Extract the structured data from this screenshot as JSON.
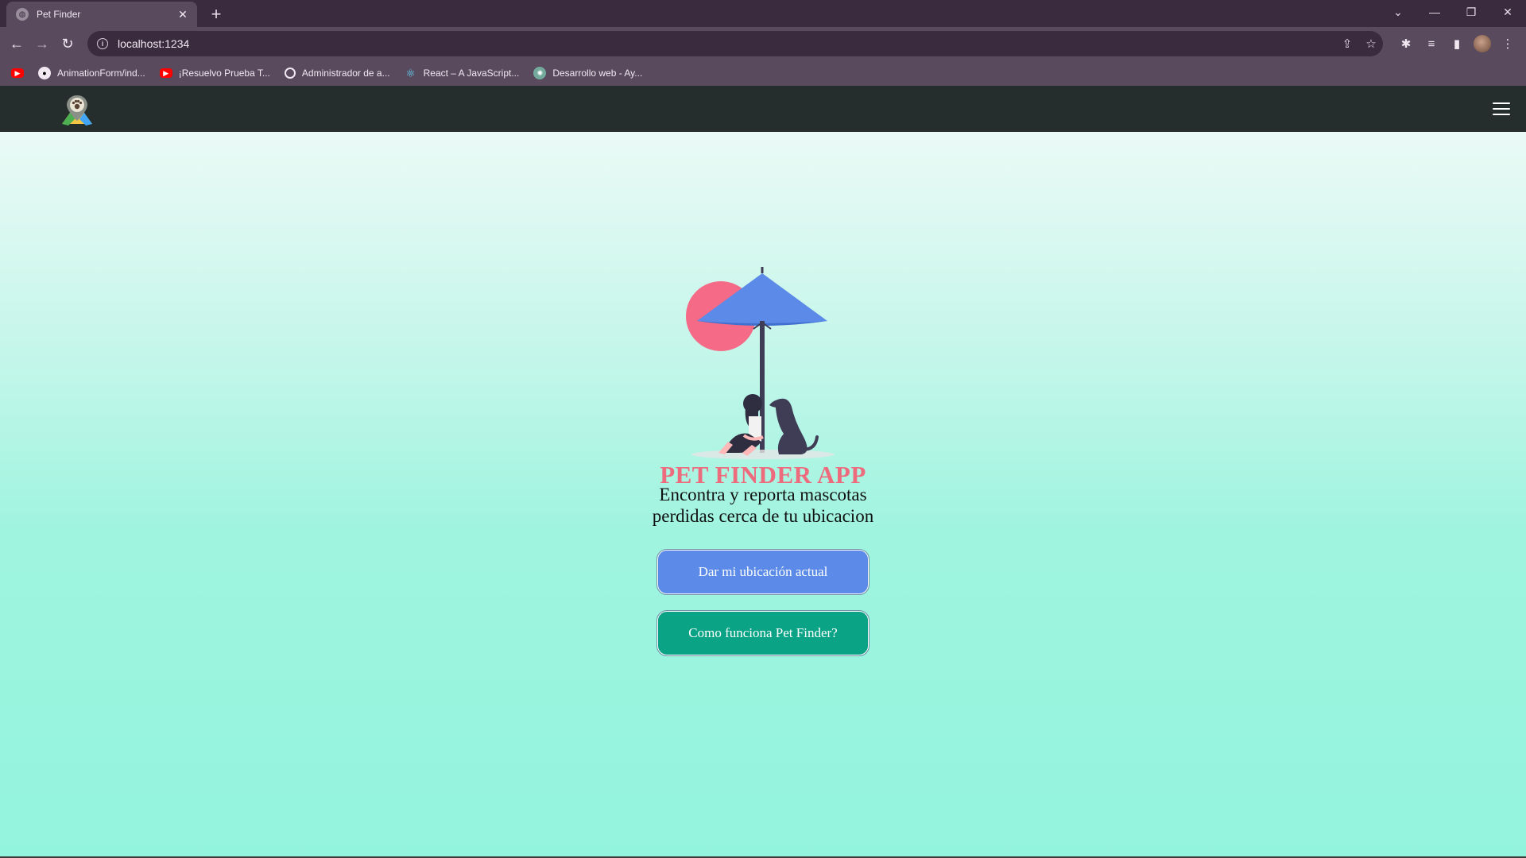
{
  "browser": {
    "tab": {
      "title": "Pet Finder"
    },
    "address_bar": {
      "url": "localhost:1234"
    },
    "bookmarks": [
      {
        "label": "",
        "icon": "youtube-icon"
      },
      {
        "label": "AnimationForm/ind...",
        "icon": "github-icon"
      },
      {
        "label": "¡Resuelvo Prueba T...",
        "icon": "youtube-icon"
      },
      {
        "label": "Administrador de a...",
        "icon": "globe-icon"
      },
      {
        "label": "React – A JavaScript...",
        "icon": "react-icon"
      },
      {
        "label": "Desarrollo web - Ay...",
        "icon": "chatgpt-icon"
      }
    ]
  },
  "app": {
    "title": "PET FINDER APP",
    "subtitle": "Encontra y reporta mascotas perdidas cerca de tu ubicacion",
    "buttons": {
      "location": "Dar mi ubicación actual",
      "how_it_works": "Como funciona Pet Finder?"
    },
    "colors": {
      "header": "#262d2d",
      "title": "#ee6b7d",
      "location_button": "#5b8ae8",
      "how_button": "#0aa386",
      "background_top": "#ebfaf6",
      "background_bottom": "#93f4de"
    }
  }
}
